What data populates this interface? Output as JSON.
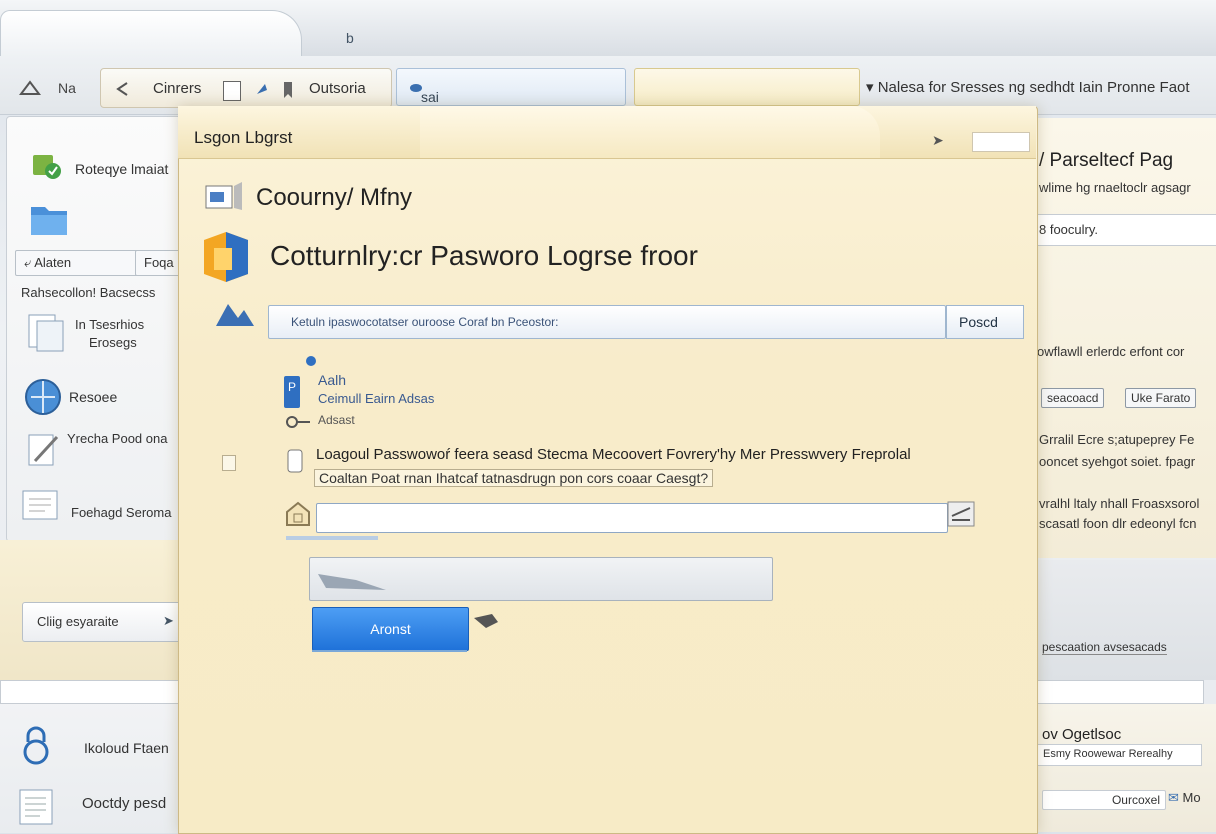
{
  "top": {
    "caret": "b"
  },
  "toolbar": {
    "left_label": "Na",
    "group_label_1": "Cinrers",
    "group_label_2": "Outsoria",
    "search_text": "sai Llorres nord.",
    "right_text": "Nalesa for Sresses ng sedhdt Iain Pronne Faot"
  },
  "left_panel": {
    "item_1": "Roteqye lmaiat",
    "btn_1": "Alaten",
    "btn_2": "Foqa",
    "heading": "Rahsecollon! Bacsecss",
    "item_2_line1": "In Tsesrhios",
    "item_2_line2": "Erosegs",
    "item_3": "Resoee",
    "item_4": "Yrecha Pood ona",
    "item_5": "Foehagd Seroma",
    "copy_button": "Cliig esyaraite",
    "bottom_item_1": "Ikoloud Ftaen",
    "bottom_item_2": "Ooctdy pesd"
  },
  "dialog": {
    "title": "Lsgon Lbgrst",
    "section_title": "Coourny/ Mfny",
    "main_title": "Cotturnlry:cr Pasworo Logrse froor",
    "url_text": "Ketuln ipaswocotatser ouroose Coraf bn Pceostor:",
    "url_button": "Poscd",
    "account_line1": "Aalh",
    "account_line2": "Ceimull Eairn Adsas",
    "account_line3": "Adsast",
    "message": "Loagoul Passwowoŕ feera seasd Stecma Mecoovert Fovrery'hy Mer Presswvery Freprolal",
    "message_sub": "Coaltan Poat rnan Ihatcaf tatnasdrugn pon cors coaar Caesgt?",
    "password_value": "",
    "confirm_value": "",
    "submit_button": "Aronst"
  },
  "right_panel": {
    "title": "/ Parseltecf Pag",
    "subtitle": "wlime hg rnaeltoclr agsagr",
    "field_value": "8 fooculry.",
    "note": "owflawll erlerdc erfont cor",
    "btn_1": "seacoacd",
    "btn_2": "Uke Farato",
    "para1_line1": "Grralil Ecre s;atupeprey Fe",
    "para1_line2": "ooncet syehgot soiet. fpagr",
    "para2_line1": "vralhl ltaly nhall Froasxsorol",
    "para2_line2": "scasatl foon dlr edeonyl fcn",
    "link": "pescaation avsesacads",
    "bottom_title": "ov Ogetlsoc",
    "bottom_sub": "Esmy Roowewar Rerealhy",
    "bottom_btn_1": "Ourcoxel",
    "bottom_btn_2": "Mo"
  },
  "colors": {
    "dialog_bg": "#f8eccb",
    "accent_blue": "#1f72d9",
    "panel_border": "#c9cfd6"
  },
  "icons": [
    "back-icon",
    "pin-icon",
    "search-icon",
    "cursor-icon",
    "user-card-icon",
    "folder-icon",
    "document-icon",
    "globe-icon",
    "pencil-icon",
    "lock-icon",
    "key-icon",
    "arrow-icon"
  ]
}
